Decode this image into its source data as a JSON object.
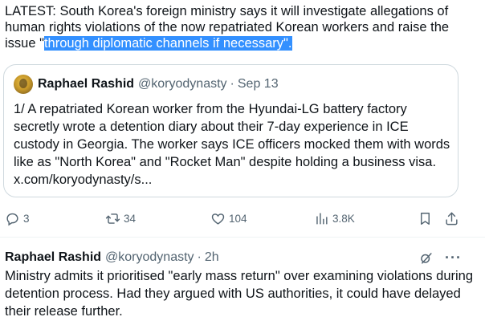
{
  "main_tweet": {
    "text_before": "LATEST: South Korea's foreign ministry says it will investigate allegations of human rights violations of the now repatriated Korean workers and raise the issue \"",
    "text_highlight": "through diplomatic channels if necessary\".",
    "highlight_color": "#3390ff"
  },
  "quote": {
    "name": "Raphael Rashid",
    "handle": "@koryodynasty",
    "separator": "·",
    "date": "Sep 13",
    "text": "1/ A repatriated Korean worker from the Hyundai-LG battery factory secretly wrote a detention diary about their 7-day experience in ICE custody in Georgia. The worker says ICE officers mocked them with words like as \"North Korea\" and \"Rocket Man\" despite holding a business visa. x.com/koryodynasty/s..."
  },
  "actions": {
    "replies": "3",
    "reposts": "34",
    "likes": "104",
    "views": "3.8K",
    "icons": [
      "reply-icon",
      "repost-icon",
      "like-icon",
      "views-icon",
      "bookmark-icon",
      "share-icon"
    ]
  },
  "reply": {
    "name": "Raphael Rashid",
    "handle": "@koryodynasty",
    "separator": "·",
    "time": "2h",
    "more": "···",
    "text": "Ministry admits it prioritised \"early mass return\" over examining violations during detention process. Had they argued with US authorities, it could have delayed their release further."
  },
  "colors": {
    "text": "#0f1419",
    "secondary": "#536471",
    "border": "#cfd9de"
  }
}
